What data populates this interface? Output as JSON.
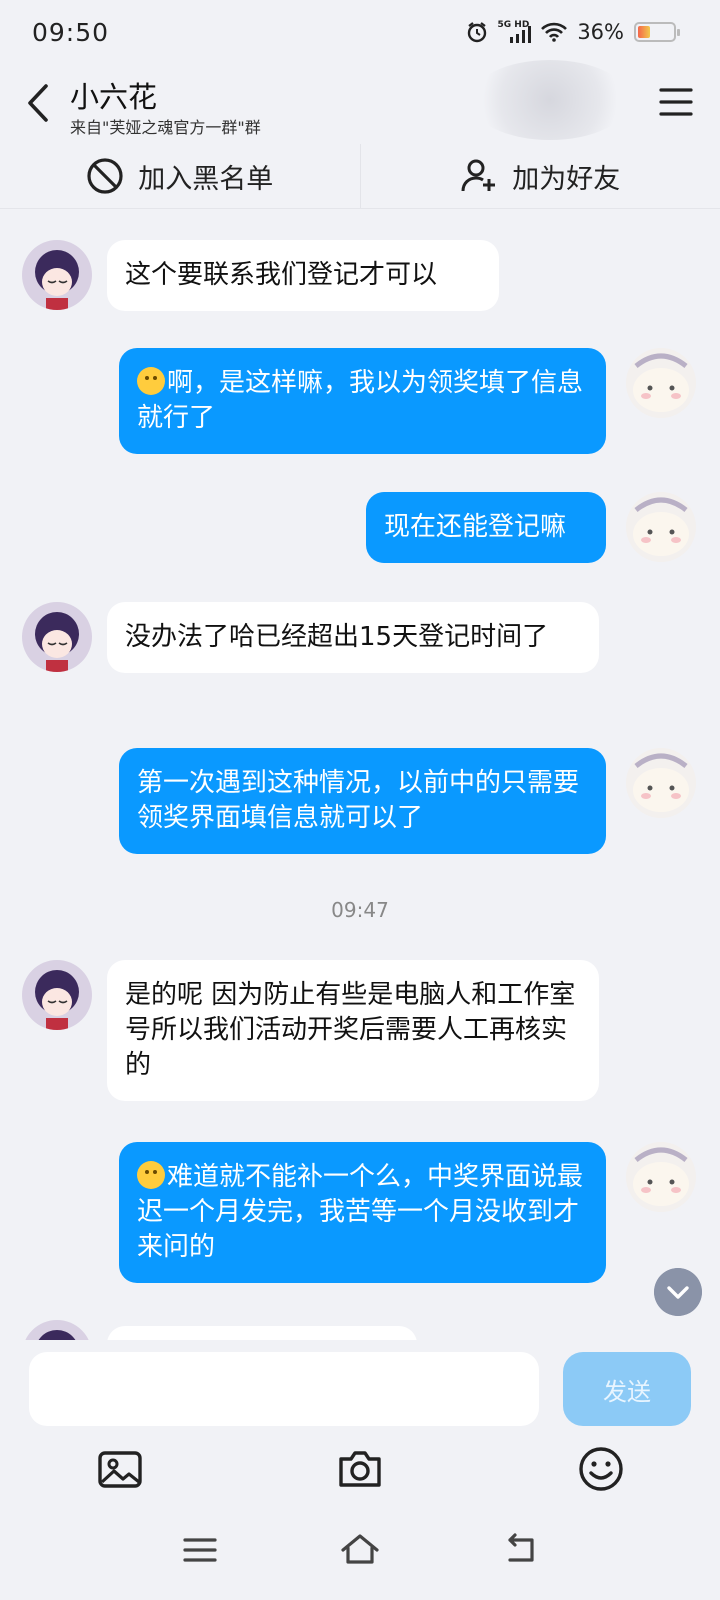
{
  "status": {
    "time": "09:50",
    "network": "5G HD",
    "battery": "36%",
    "battery_level": 0.36
  },
  "header": {
    "title": "小六花",
    "subtitle": "来自\"芙娅之魂官方一群\"群"
  },
  "actions": {
    "blacklist": "加入黑名单",
    "add_friend": "加为好友"
  },
  "messages": [
    {
      "side": "left",
      "text": "这个要联系我们登记才可以"
    },
    {
      "side": "right",
      "emoji": "laughing-emoji",
      "text": "啊，是这样嘛，我以为领奖填了信息就行了"
    },
    {
      "side": "right",
      "text": "现在还能登记嘛"
    },
    {
      "side": "left",
      "text": "没办法了哈已经超出15天登记时间了"
    },
    {
      "side": "right",
      "text": "第一次遇到这种情况，以前中的只需要领奖界面填信息就可以了"
    },
    {
      "side": "left",
      "text": "是的呢 因为防止有些是电脑人和工作室号所以我们活动开奖后需要人工再核实的"
    },
    {
      "side": "right",
      "emoji": "sad-emoji",
      "text": "难道就不能补一个么，中奖界面说最迟一个月发完，我苦等一个月没收到才来问的"
    }
  ],
  "timestamp": "09:47",
  "input": {
    "placeholder": "",
    "send_label": "发送"
  },
  "colors": {
    "accent": "#0a99ff",
    "send_disabled": "#8ccaf6",
    "background": "#f1f2f6"
  }
}
